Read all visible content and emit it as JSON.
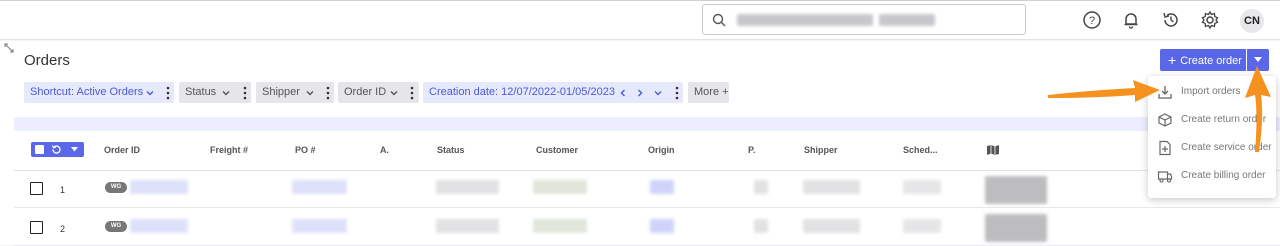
{
  "header": {
    "avatar_initials": "CN",
    "icons": [
      "help-icon",
      "bell-icon",
      "history-icon",
      "gear-icon"
    ]
  },
  "page": {
    "title": "Orders"
  },
  "filters": {
    "shortcut": {
      "label": "Shortcut:",
      "value": "Active Orders"
    },
    "status": "Status",
    "shipper": "Shipper",
    "order_id": "Order ID",
    "creation_date": {
      "label": "Creation date:",
      "value": "12/07/2022-01/05/2023"
    },
    "more": "More +"
  },
  "actions": {
    "create_order": "Create order"
  },
  "create_menu": {
    "items": [
      {
        "label": "Import orders",
        "icon": "import-icon"
      },
      {
        "label": "Create return order",
        "icon": "return-box-icon"
      },
      {
        "label": "Create service order",
        "icon": "service-doc-icon"
      },
      {
        "label": "Create billing order",
        "icon": "billing-truck-icon"
      }
    ]
  },
  "table": {
    "columns": [
      "Order ID",
      "Freight #",
      "PO #",
      "A.",
      "Status",
      "Customer",
      "Origin",
      "P.",
      "Shipper",
      "Sched..."
    ],
    "rows": [
      {
        "num": "1",
        "badge": "WG"
      },
      {
        "num": "2",
        "badge": "WG"
      }
    ]
  },
  "colors": {
    "accent": "#5967e8",
    "annotation_arrow": "#f5911e"
  }
}
